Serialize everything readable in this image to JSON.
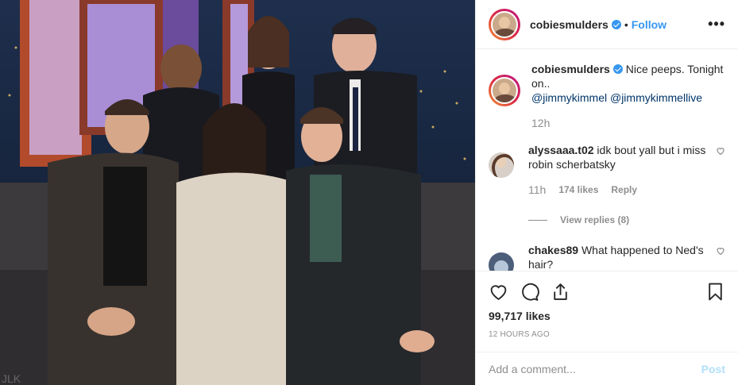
{
  "post": {
    "username": "cobiesmulders",
    "follow_label": "Follow",
    "separator": "•",
    "more_label": "•••"
  },
  "caption": {
    "username": "cobiesmulders",
    "text": "Nice peeps. Tonight on..",
    "mention1": "@jimmykimmel",
    "mention2": "@jimmykimmellive",
    "time": "12h"
  },
  "comments": [
    {
      "username": "alyssaaa.t02",
      "text": "idk bout yall but i miss robin scherbatsky",
      "time": "11h",
      "likes": "174 likes",
      "reply": "Reply",
      "view_replies": "View replies (8)"
    },
    {
      "username": "chakes89",
      "text": "What happened to Ned's hair?"
    }
  ],
  "actions": {
    "likes_count": "99,717 likes",
    "time_ago": "12 HOURS AGO"
  },
  "add_comment": {
    "placeholder": "Add a comment...",
    "post_label": "Post"
  },
  "colors": {
    "link": "#3897f0",
    "mention": "#003569",
    "muted": "#8e8e8e",
    "post_disabled": "#b2dffc"
  },
  "icons": {
    "like": "heart-icon",
    "comment": "comment-icon",
    "share": "share-icon",
    "save": "bookmark-icon",
    "more": "more-icon",
    "verified": "verified-icon"
  }
}
